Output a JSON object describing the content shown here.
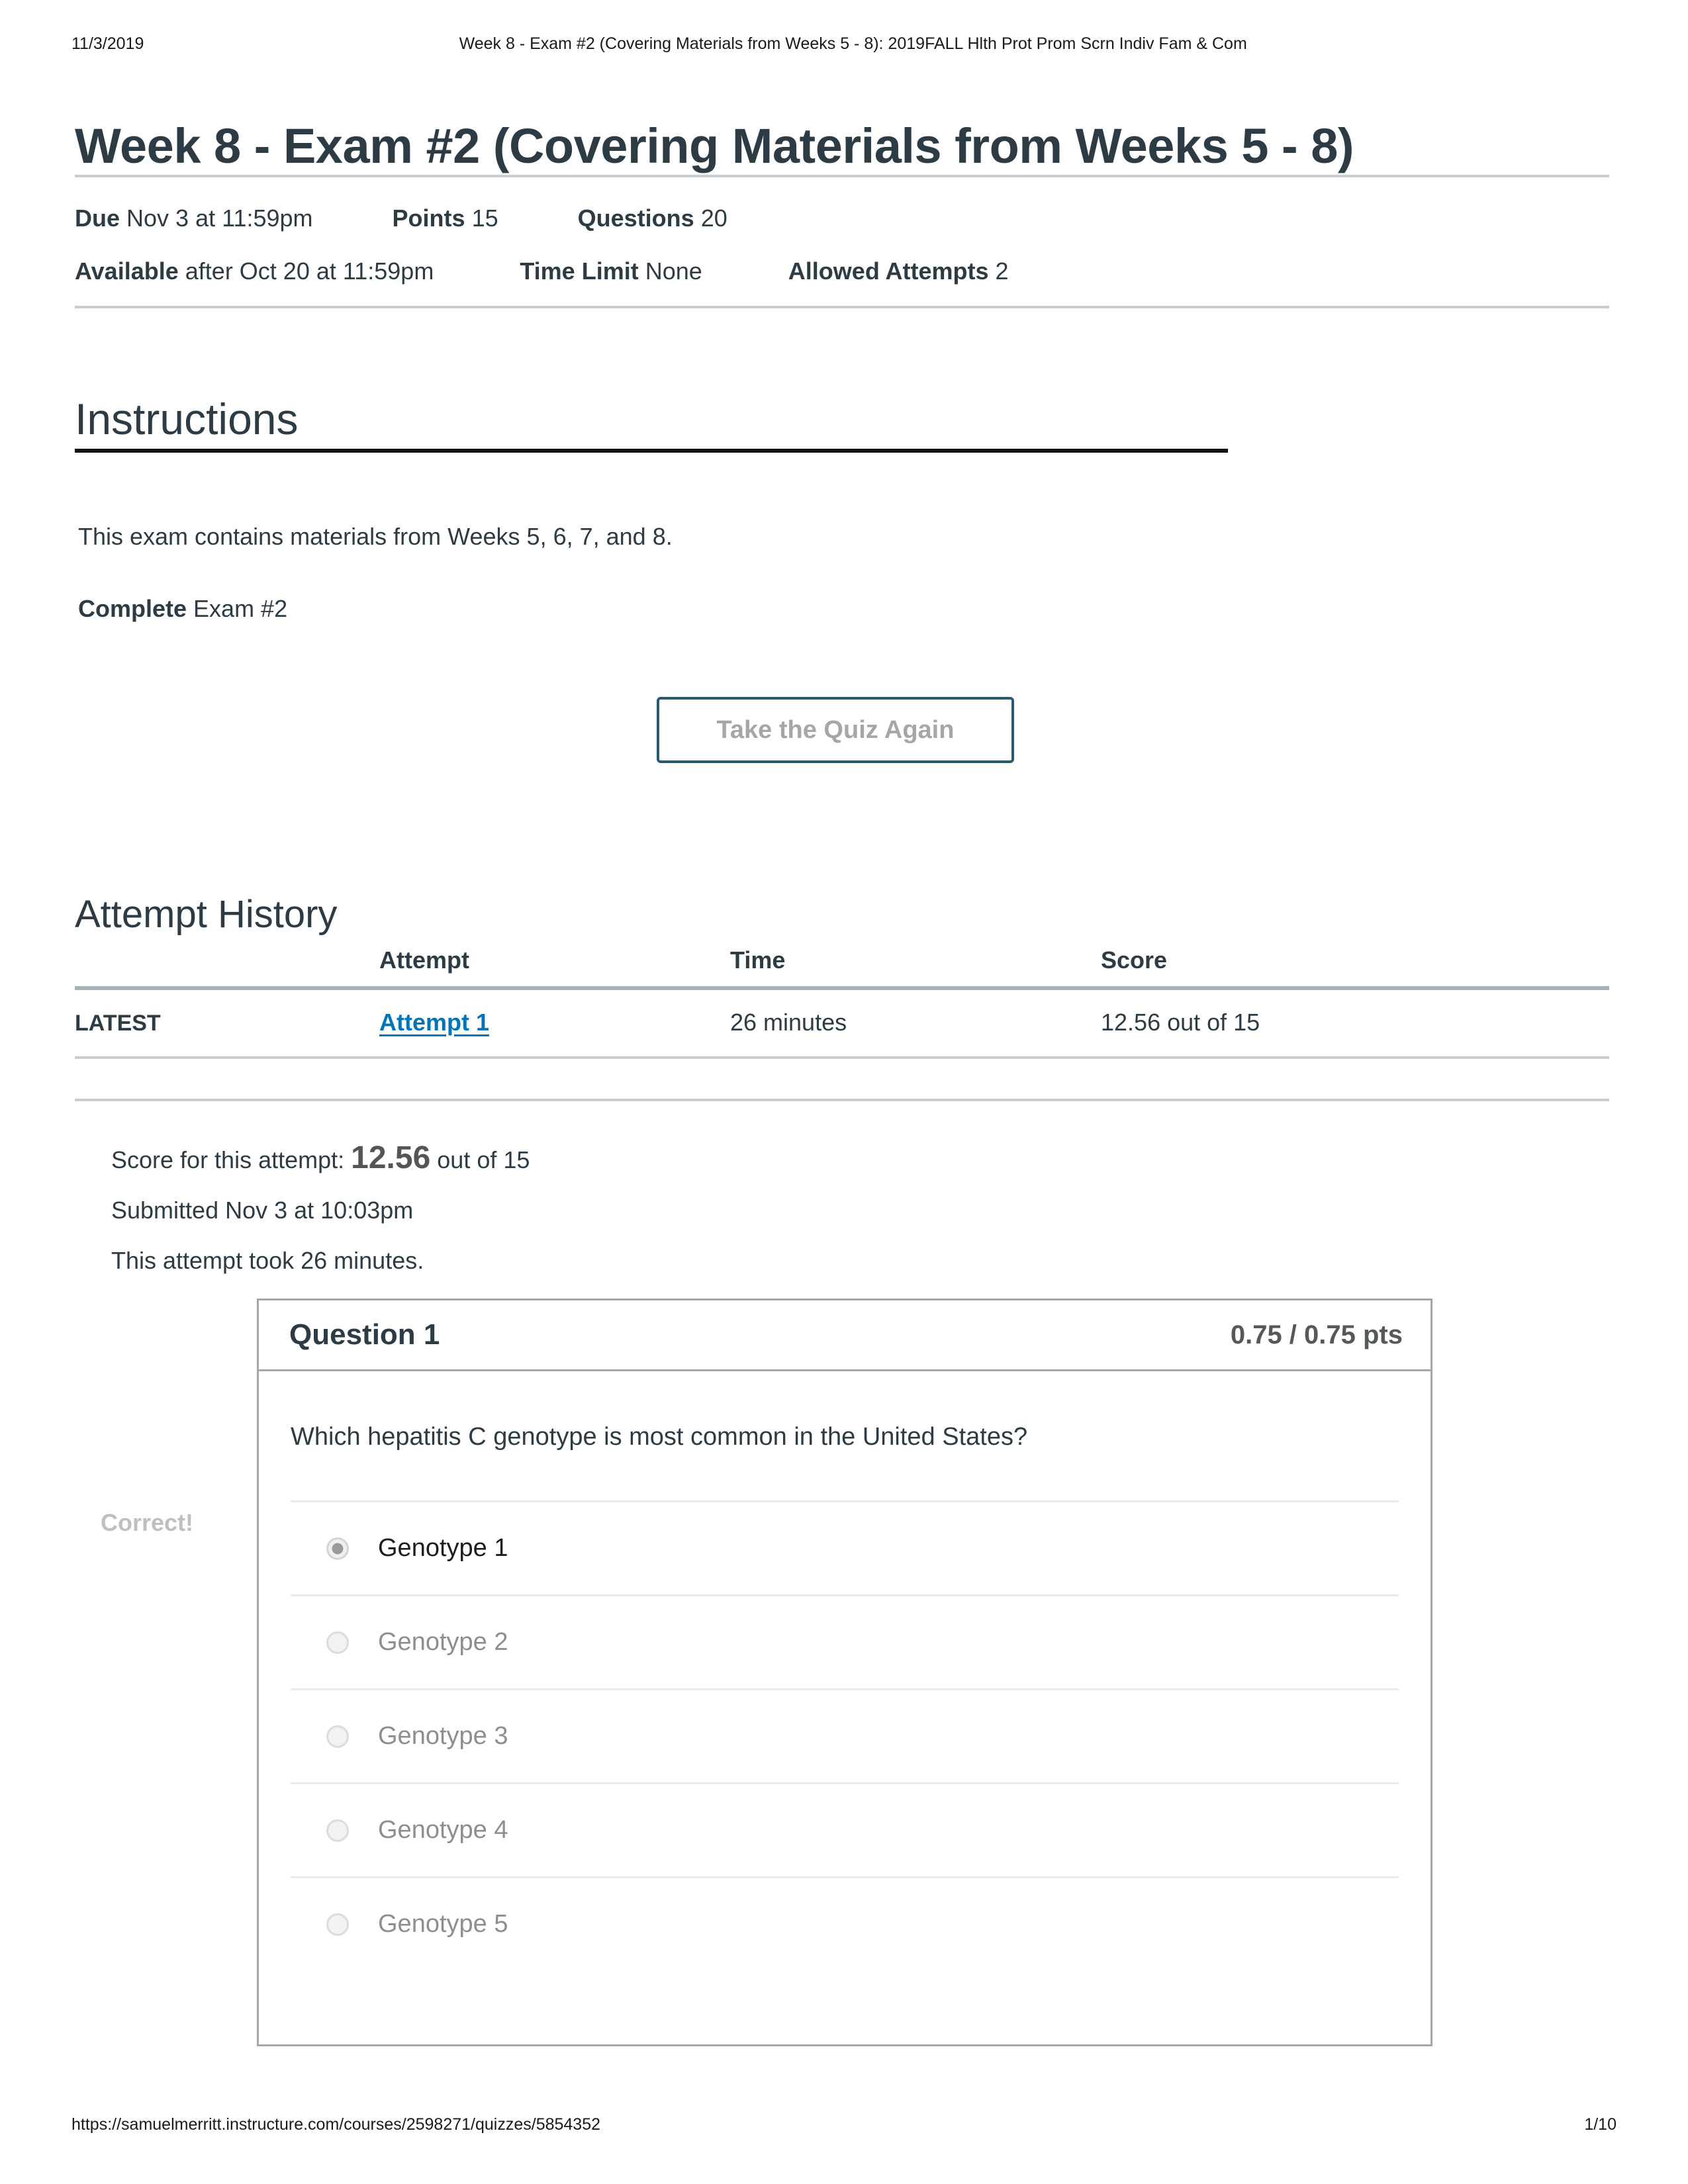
{
  "print_header": {
    "date": "11/3/2019",
    "title": "Week 8 - Exam #2 (Covering Materials from Weeks 5 - 8): 2019FALL Hlth Prot Prom Scrn Indiv Fam & Com"
  },
  "quiz": {
    "title": "Week 8 - Exam #2 (Covering Materials from Weeks 5 - 8)",
    "meta": {
      "due_label": "Due",
      "due_value": "Nov 3 at 11:59pm",
      "points_label": "Points",
      "points_value": "15",
      "questions_label": "Questions",
      "questions_value": "20",
      "available_label": "Available",
      "available_value": "after Oct 20 at 11:59pm",
      "time_limit_label": "Time Limit",
      "time_limit_value": "None",
      "allowed_attempts_label": "Allowed Attempts",
      "allowed_attempts_value": "2"
    }
  },
  "instructions": {
    "heading": "Instructions",
    "paragraph": "This exam contains materials from Weeks 5, 6, 7, and 8.",
    "complete_label": "Complete",
    "complete_value": " Exam #2"
  },
  "actions": {
    "take_quiz_again": "Take the Quiz Again"
  },
  "attempt_history": {
    "heading": "Attempt History",
    "columns": {
      "blank": "",
      "attempt": "Attempt",
      "time": "Time",
      "score": "Score"
    },
    "rows": [
      {
        "latest": "LATEST",
        "attempt": "Attempt 1 ",
        "time": "26 minutes",
        "score": "12.56 out of 15"
      }
    ]
  },
  "attempt_summary": {
    "score_prefix": "Score for this attempt: ",
    "score_value": "12.56",
    "score_suffix": " out of 15",
    "submitted": "Submitted Nov 3 at 10:03pm",
    "duration": "This attempt took 26 minutes."
  },
  "question": {
    "flag": "Correct!",
    "name": "Question 1",
    "points": "0.75 / 0.75 pts",
    "text": "Which hepatitis C genotype is most common in the United States?",
    "answers": [
      {
        "label": "Genotype 1",
        "selected": true
      },
      {
        "label": "Genotype 2",
        "selected": false
      },
      {
        "label": "Genotype 3",
        "selected": false
      },
      {
        "label": "Genotype 4",
        "selected": false
      },
      {
        "label": "Genotype 5",
        "selected": false
      }
    ]
  },
  "print_footer": {
    "url": "https://samuelmerritt.instructure.com/courses/2598271/quizzes/5854352",
    "page": "1/10"
  },
  "colors": {
    "link": "#0374B5",
    "button_border": "#2B5871",
    "muted_text": "#8b8f92",
    "heading_text": "#2D3B45"
  }
}
